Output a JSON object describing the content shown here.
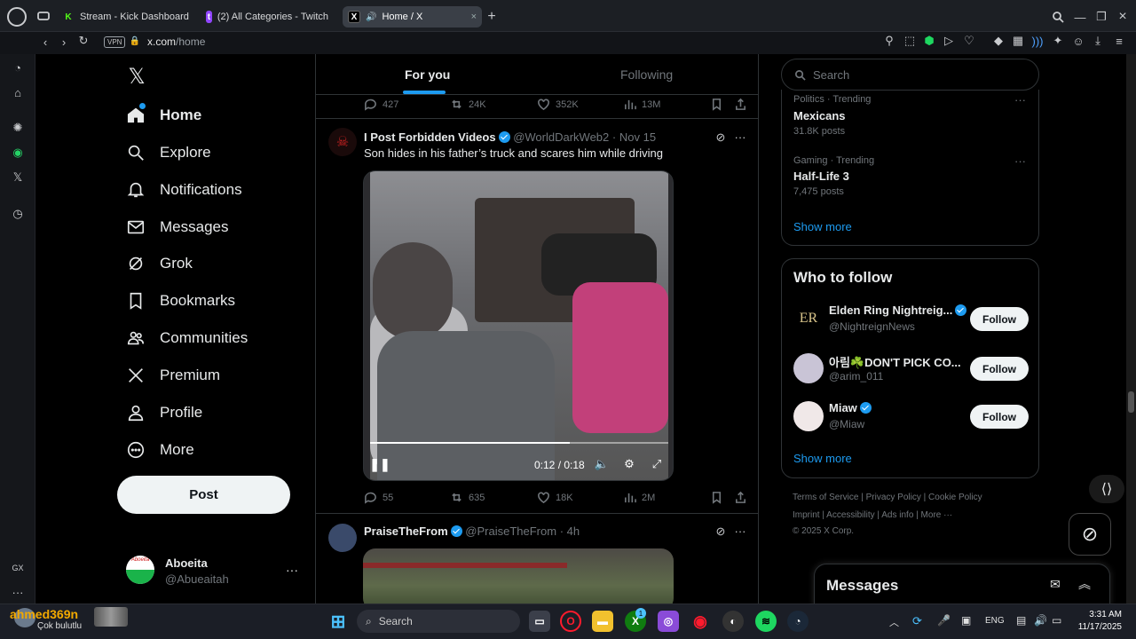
{
  "browser": {
    "tabs": [
      {
        "label": "Stream - Kick Dashboard",
        "icon": "kick-icon",
        "color": "#53fc18"
      },
      {
        "label": "(2) All Categories - Twitch",
        "icon": "twitch-icon",
        "color": "#9146ff"
      },
      {
        "label": "Home / X",
        "icon": "x-icon",
        "color": "#ffffff"
      }
    ],
    "url_host": "x.com",
    "url_path": "/home",
    "vpn_label": "VPN"
  },
  "nav": {
    "items": [
      {
        "label": "Home",
        "icon": "home-icon"
      },
      {
        "label": "Explore",
        "icon": "search-icon"
      },
      {
        "label": "Notifications",
        "icon": "bell-icon"
      },
      {
        "label": "Messages",
        "icon": "mail-icon"
      },
      {
        "label": "Grok",
        "icon": "grok-icon"
      },
      {
        "label": "Bookmarks",
        "icon": "bookmark-icon"
      },
      {
        "label": "Communities",
        "icon": "communities-icon"
      },
      {
        "label": "Premium",
        "icon": "x-icon"
      },
      {
        "label": "Profile",
        "icon": "person-icon"
      },
      {
        "label": "More",
        "icon": "more-circle-icon"
      }
    ],
    "post_label": "Post",
    "account": {
      "name": "Aboeita",
      "handle": "@Abueaitah",
      "avatar_text": "Aboeita"
    }
  },
  "feed": {
    "tabs": [
      "For you",
      "Following"
    ],
    "top_actions": {
      "replies": "427",
      "reposts": "24K",
      "likes": "352K",
      "views": "13M"
    },
    "tweet1": {
      "name": "I Post Forbidden Videos",
      "handle": "@WorldDarkWeb2",
      "date": "Nov 15",
      "text": "Son hides in his father’s truck and scares him while driving",
      "video_time": "0:12 / 0:18",
      "video_progress": 0.67,
      "actions": {
        "replies": "55",
        "reposts": "635",
        "likes": "18K",
        "views": "2M"
      }
    },
    "tweet2": {
      "name": "PraiseTheFrom",
      "handle": "@PraiseTheFrom",
      "date": "4h"
    }
  },
  "sidebar": {
    "search_placeholder": "Search",
    "trends": [
      {
        "context": "Politics · Trending",
        "title": "Mexicans",
        "count": "31.8K posts"
      },
      {
        "context": "Gaming · Trending",
        "title": "Half-Life 3",
        "count": "7,475 posts"
      }
    ],
    "trends_show_more": "Show more",
    "who_to_follow_title": "Who to follow",
    "follow": [
      {
        "name": "Elden Ring Nightreig...",
        "handle": "@NightreignNews",
        "avatar_text": "ER",
        "verified": true
      },
      {
        "name": "아림☘️DON'T PICK CO...",
        "handle": "@arim_011",
        "avatar_text": "",
        "verified": false
      },
      {
        "name": "Miaw",
        "handle": "@Miaw",
        "avatar_text": "",
        "verified": true
      }
    ],
    "follow_label": "Follow",
    "follow_show_more": "Show more",
    "footer": {
      "links1": [
        "Terms of Service",
        "Privacy Policy",
        "Cookie Policy"
      ],
      "links2": [
        "Imprint",
        "Accessibility",
        "Ads info",
        "More ···"
      ],
      "copyright": "© 2025 X Corp."
    },
    "messages_title": "Messages"
  },
  "taskbar": {
    "weather_user": "ahmed369n",
    "weather_text": "Çok bulutlu",
    "search_label": "Search",
    "lang": "ENG",
    "time": "3:31 AM",
    "date": "11/17/2025",
    "badge": "1"
  },
  "opera_sidebar": {
    "gx_label": "GX"
  }
}
